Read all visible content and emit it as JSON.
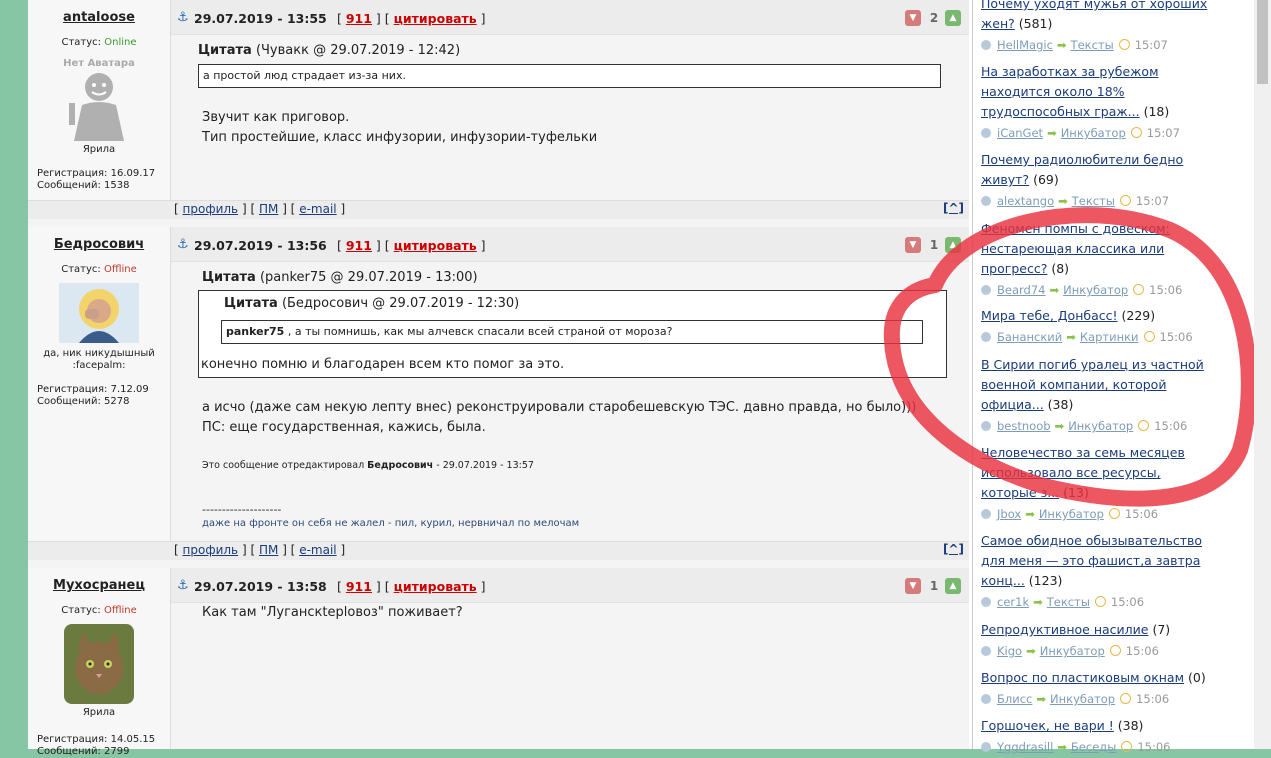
{
  "posts": [
    {
      "author": "antaloose",
      "status_label": "Статус:",
      "status": "Online",
      "avatar_text": "Нет Аватара",
      "rank": "Ярила",
      "reg": "Регистрация: 16.09.17",
      "msgs": "Сообщений: 1538",
      "date": "29.07.2019 - 13:55",
      "num": "911",
      "quote_label": "цитировать",
      "rating": "2",
      "quote_title": "Цитата",
      "quote_src": "(Чувакк @ 29.07.2019 - 12:42)",
      "quote_text": "а простой люд страдает из-за них.",
      "body": [
        "Звучит как приговор.",
        "Тип простейшие, класс инфузории, инфузории-туфельки"
      ]
    },
    {
      "author": "Бедросович",
      "status_label": "Статус:",
      "status": "Offline",
      "rank": "да, ник никудышный :facepalm:",
      "reg": "Регистрация: 7.12.09",
      "msgs": "Сообщений: 5278",
      "date": "29.07.2019 - 13:56",
      "num": "911",
      "quote_label": "цитировать",
      "rating": "1",
      "quote_title": "Цитата",
      "quote_src": "(panker75 @ 29.07.2019 - 13:00)",
      "inner_quote_title": "Цитата",
      "inner_quote_src": "(Бедросович @ 29.07.2019 - 12:30)",
      "inner_quote_user": "panker75",
      "inner_quote_text": ", а ты помнишь, как мы алчевск спасали всей страной от мороза?",
      "quote_text": "конечно помню и благодарен всем кто помог за это.",
      "body": [
        "а исчо (даже сам некую лепту внес) реконструировали старобешевскую ТЭС. давно правда, но было)))",
        "ПС: еще государственная, кажись, была."
      ],
      "edited_prefix": "Это сообщение отредактировал",
      "edited_user": "Бедросович",
      "edited_date": "- 29.07.2019 - 13:57",
      "sig_line": "--------------------",
      "signature": "даже на фронте он себя не жалел - пил, курил, нервничал по мелочам"
    },
    {
      "author": "Мухосранец",
      "status_label": "Статус:",
      "status": "Offline",
      "rank": "Ярила",
      "reg": "Регистрация: 14.05.15",
      "msgs": "Сообщений: 2799",
      "date": "29.07.2019 - 13:58",
      "num": "911",
      "quote_label": "цитировать",
      "rating": "1",
      "body": [
        "Как там \"Луганскteplовоз\" поживает?"
      ]
    }
  ],
  "footer": {
    "open": "[",
    "profile": "профиль",
    "sep": "] [",
    "pm": "ПМ",
    "email": "e-mail",
    "close": "]",
    "up": "[^]"
  },
  "sidebar": [
    {
      "title": "Почему уходят мужья от хороших жен?",
      "count": "(581)",
      "user": "HellMagic",
      "cat": "Тексты",
      "time": "15:07"
    },
    {
      "title": "На заработках за рубежом находится около 18% трудоспособных граж...",
      "count": "(18)",
      "user": "iCanGet",
      "cat": "Инкубатор",
      "time": "15:07"
    },
    {
      "title": "Почему радиолюбители бедно живут?",
      "count": "(69)",
      "user": "alextango",
      "cat": "Тексты",
      "time": "15:07"
    },
    {
      "title": "Феномен помпы с довеском: нестареющая классика или прогресс?",
      "count": "(8)",
      "user": "Beard74",
      "cat": "Инкубатор",
      "time": "15:06"
    },
    {
      "title": "Мира тебе, Донбасс!",
      "count": "(229)",
      "user": "Банaнский",
      "cat": "Картинки",
      "time": "15:06"
    },
    {
      "title": "В Сирии погиб уралец из частной военной компании, которой официа...",
      "count": "(38)",
      "user": "bestnoob",
      "cat": "Инкубатор",
      "time": "15:06"
    },
    {
      "title": "Человечество за семь месяцев использовало все ресурсы, которые з...",
      "count": "(13)",
      "user": "Jbox",
      "cat": "Инкубатор",
      "time": "15:06"
    },
    {
      "title": "Самое обидное обызывательство для меня — это фашист,а завтра конц...",
      "count": "(123)",
      "user": "cer1k",
      "cat": "Тексты",
      "time": "15:06"
    },
    {
      "title": "Репродуктивное насилие",
      "count": "(7)",
      "user": "Kigo",
      "cat": "Инкубатор",
      "time": "15:06"
    },
    {
      "title": "Вопрос по пластиковым окнам",
      "count": "(0)",
      "user": "Блисс",
      "cat": "Инкубатор",
      "time": "15:06"
    },
    {
      "title": "Горшочек, не вари !",
      "count": "(38)",
      "user": "Yggdrasill",
      "cat": "Беседы",
      "time": "15:06"
    }
  ]
}
